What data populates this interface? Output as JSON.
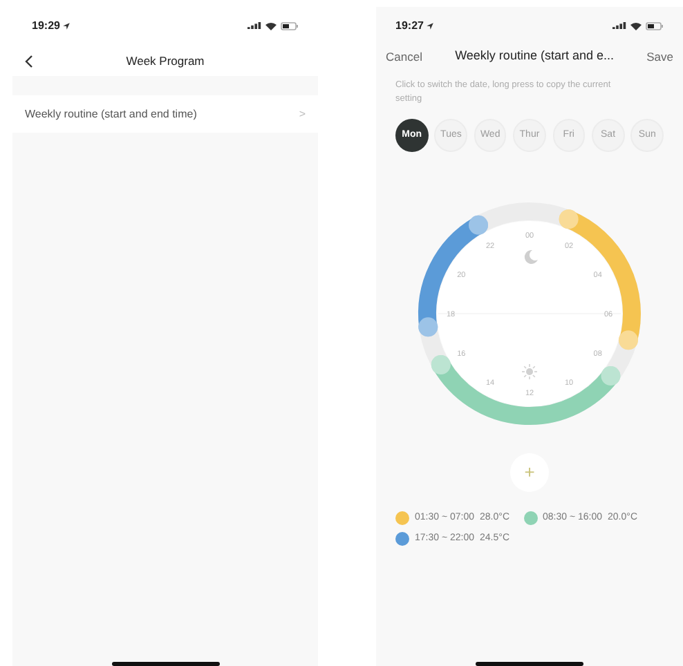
{
  "screens": [
    {
      "status_bar": {
        "time": "19:29"
      },
      "nav": {
        "title": "Week Program"
      },
      "rows": [
        {
          "label": "Weekly routine (start and end time)",
          "chevron": ">"
        }
      ]
    },
    {
      "status_bar": {
        "time": "19:27"
      },
      "header": {
        "cancel": "Cancel",
        "title": "Weekly routine (start and e...",
        "save": "Save"
      },
      "hint": "Click to switch the date, long press to copy the current setting",
      "days": [
        {
          "label": "Mon",
          "selected": true
        },
        {
          "label": "Tues",
          "selected": false
        },
        {
          "label": "Wed",
          "selected": false
        },
        {
          "label": "Thur",
          "selected": false
        },
        {
          "label": "Fri",
          "selected": false
        },
        {
          "label": "Sat",
          "selected": false
        },
        {
          "label": "Sun",
          "selected": false
        }
      ],
      "dial_labels": [
        "00",
        "02",
        "04",
        "06",
        "08",
        "10",
        "12",
        "14",
        "16",
        "18",
        "20",
        "22"
      ],
      "segments": [
        {
          "time": "01:30 ~ 07:00",
          "temperature": "28.0°C",
          "color": "#f5c451"
        },
        {
          "time": "08:30 ~ 16:00",
          "temperature": "20.0°C",
          "color": "#8fd3b4"
        },
        {
          "time": "17:30 ~ 22:00",
          "temperature": "24.5°C",
          "color": "#5b9bd8"
        }
      ],
      "add_button": "+"
    }
  ]
}
